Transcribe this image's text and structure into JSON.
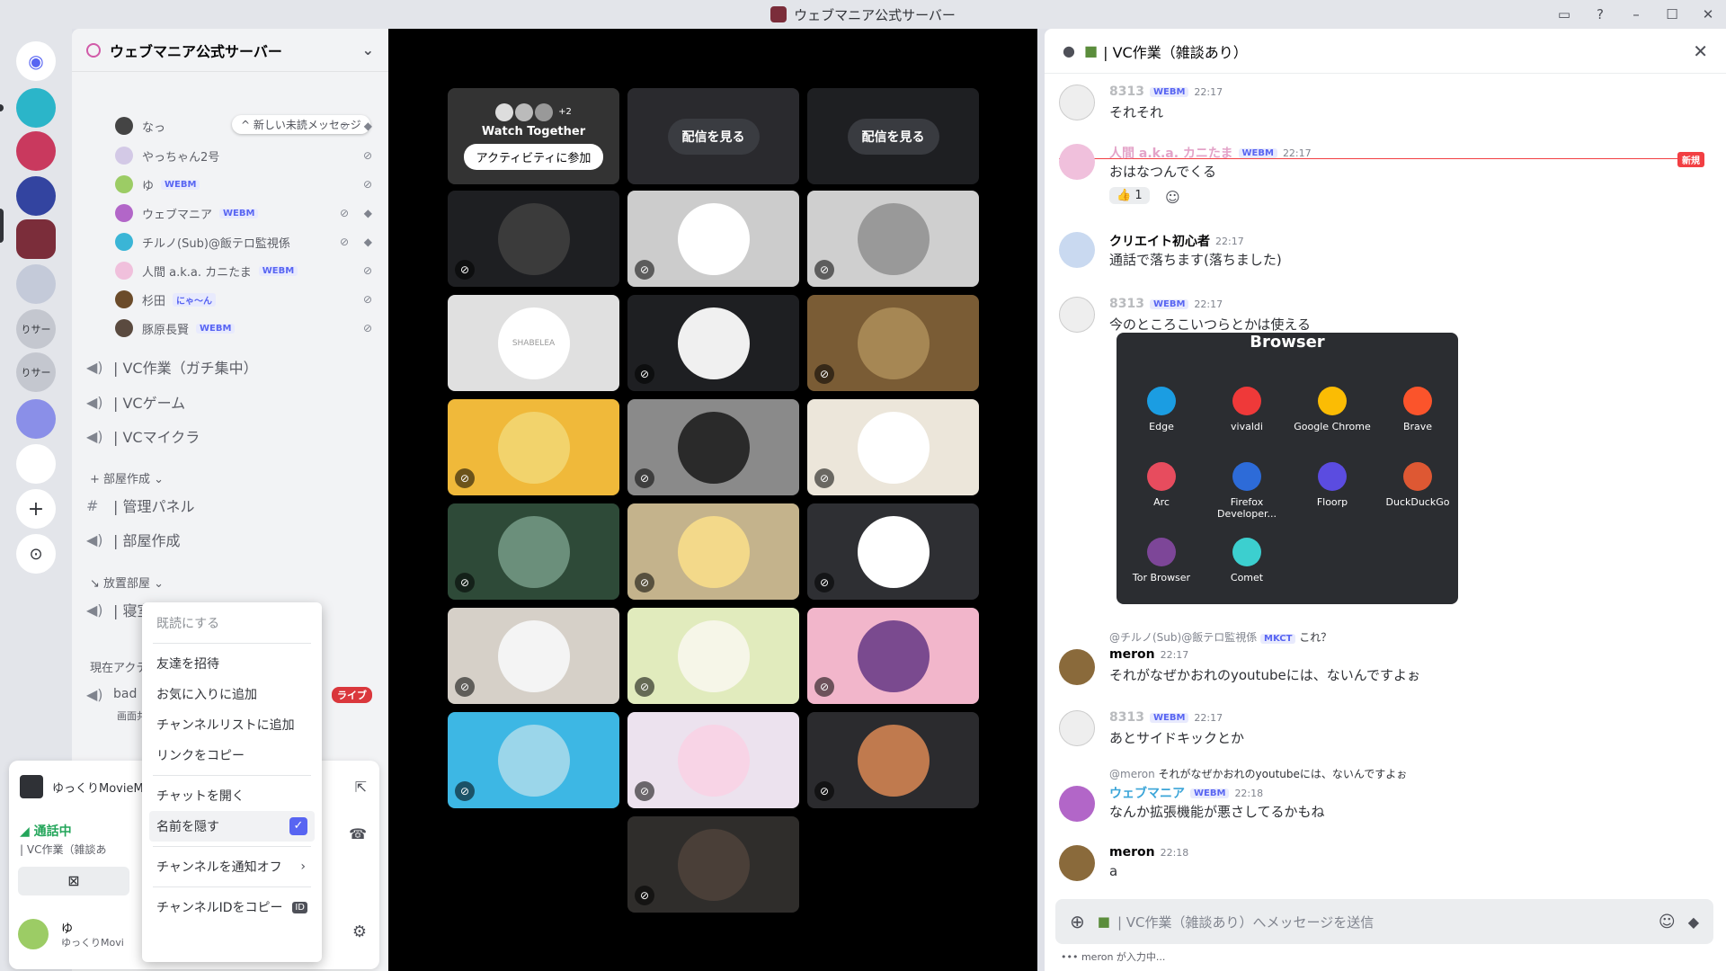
{
  "window": {
    "title": "ウェブマニア公式サーバー"
  },
  "server": {
    "name": "ウェブマニア公式サーバー",
    "new_unread": "新しい未読メッセージ"
  },
  "voice_users": [
    {
      "name": "なっ",
      "tag": ""
    },
    {
      "name": "やっちゃん2号",
      "tag": ""
    },
    {
      "name": "ゆ",
      "tag": "WEBM"
    },
    {
      "name": "ウェブマニア",
      "tag": "WEBM"
    },
    {
      "name": "チルノ(Sub)@飯テロ監視係",
      "tag": ""
    },
    {
      "name": "人間 a.k.a. カニたま",
      "tag": "WEBM"
    },
    {
      "name": "杉田",
      "tag": "にゃ〜ん"
    },
    {
      "name": "豚原長賢",
      "tag": "WEBM"
    }
  ],
  "channels": [
    {
      "name": "| VC作業（ガチ集中）"
    },
    {
      "name": "| VCゲーム"
    },
    {
      "name": "| VCマイクラ"
    }
  ],
  "category1": "部屋作成",
  "channels2": [
    {
      "name": "| 管理パネル"
    },
    {
      "name": "| 部屋作成"
    }
  ],
  "category2": "放置部屋",
  "channels3": [
    {
      "name": "| 寝室"
    }
  ],
  "current_activity": {
    "label": "現在アクテ",
    "user": "bad",
    "sub": "画面共",
    "live": "ライブ"
  },
  "voice_panel": {
    "app": "ゆっくりMovieM",
    "status": "通話中",
    "channel": "| VC作業（雑談あ",
    "user": "ゆ",
    "user_sub": "ゆっくりMovi"
  },
  "context_menu": {
    "items": [
      "既読にする",
      "友達を招待",
      "お気に入りに追加",
      "チャンネルリストに追加",
      "リンクをコピー",
      "チャットを開く",
      "名前を隠す",
      "チャンネルを通知オフ",
      "チャンネルIDをコピー"
    ],
    "id_badge": "ID"
  },
  "stage": {
    "watch_together": "Watch Together",
    "join_activity": "アクティビティに参加",
    "plus_count": "+2",
    "watch_stream": "配信を見る",
    "shabelea": "SHABELEA"
  },
  "chat": {
    "header": "| VC作業（雑談あり）",
    "new_label": "新規",
    "messages": [
      {
        "name": "8313",
        "tag": "WEBM",
        "time": "22:17",
        "text": "それそれ",
        "color": "#b9bbbe"
      },
      {
        "name": "人間 a.k.a. カニたま",
        "tag": "WEBM",
        "time": "22:17",
        "text": "おはなつんでくる",
        "color": "#e3a3c8"
      },
      {
        "name": "クリエイト初心者",
        "tag": "",
        "time": "22:17",
        "text": "通話で落ちます(落ちました)",
        "color": "#060607"
      },
      {
        "name": "8313",
        "tag": "WEBM",
        "time": "22:17",
        "text": "今のところこいつらとかは使える",
        "color": "#b9bbbe"
      },
      {
        "name": "meron",
        "tag": "",
        "time": "22:17",
        "text": "それがなぜかおれのyoutubeには、ないんですよぉ",
        "color": "#060607"
      },
      {
        "name": "8313",
        "tag": "WEBM",
        "time": "22:17",
        "text": "あとサイドキックとか",
        "color": "#b9bbbe"
      },
      {
        "name": "ウェブマニア",
        "tag": "WEBM",
        "time": "22:18",
        "text": "なんか拡張機能が悪さしてるかもね",
        "color": "#3ba5d8"
      },
      {
        "name": "meron",
        "tag": "",
        "time": "22:18",
        "text": "a",
        "color": "#060607"
      }
    ],
    "reaction_count": "1",
    "reply1": {
      "user": "@チルノ(Sub)@飯テロ監視係",
      "tag": "MKCT",
      "text": "これ？"
    },
    "reply2": {
      "user": "@meron",
      "text": "それがなぜかおれのyoutubeには、ないんですよぉ"
    },
    "composer_placeholder": "| VC作業（雑談あり）へメッセージを送信",
    "typing": "meron が入力中..."
  },
  "browser_card": {
    "title": "Browser",
    "items": [
      "Edge",
      "vivaldi",
      "Google Chrome",
      "Brave",
      "Arc",
      "Firefox Developer...",
      "Floorp",
      "DuckDuckGo",
      "Tor Browser",
      "Comet"
    ],
    "colors": [
      "#1b9de2",
      "#ef3939",
      "#fbbc04",
      "#fb542b",
      "#e74c5e",
      "#2d6bd8",
      "#5b4ce0",
      "#de5833",
      "#7d4698",
      "#3ccfcf"
    ]
  }
}
